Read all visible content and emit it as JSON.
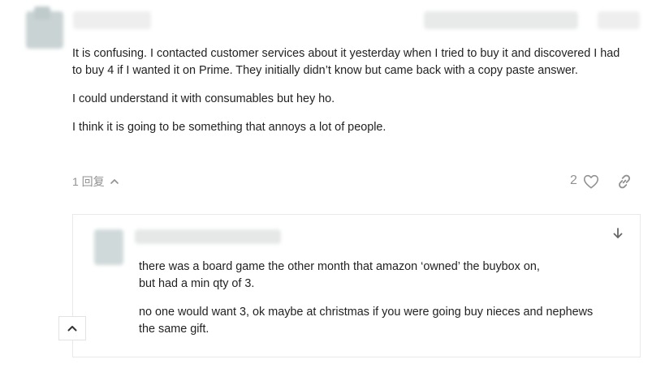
{
  "post": {
    "paragraphs": [
      "It is confusing. I contacted customer services about it yesterday when I tried to buy it and discovered I had to buy 4 if I wanted it on Prime. They initially didn’t know but came back with a copy paste answer.",
      "I could understand it with consumables but hey ho.",
      "I think it is going to be something that annoys a lot of people."
    ],
    "replies_label": "1 回复",
    "like_count": "2"
  },
  "embedded_reply": {
    "lines": [
      "there was a board game the other month that amazon ‘owned’ the buybox on,",
      "but had a min qty of 3."
    ],
    "second_lines": [
      "no one would want 3, ok maybe at christmas if you were going buy nieces and nephews",
      "the same gift."
    ]
  },
  "icons": {
    "replies_toggle": "chevron-up-icon",
    "like": "heart-icon",
    "link": "link-icon",
    "jump": "arrow-down-icon",
    "collapse": "chevron-up-icon"
  },
  "colors": {
    "muted_text": "#919191",
    "body_text": "#222222",
    "border": "#e9e9e9"
  }
}
